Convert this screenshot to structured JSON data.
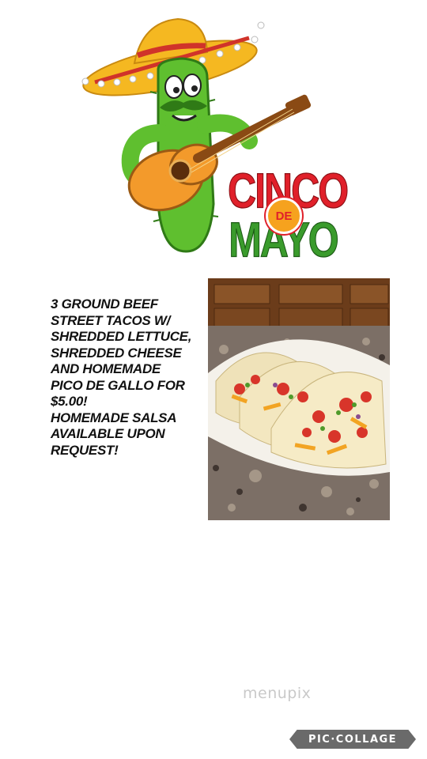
{
  "logo": {
    "word_top": "CINCO",
    "word_badge": "DE",
    "word_bottom": "MAYO"
  },
  "promo_lines": [
    "3 GROUND BEEF",
    "STREET TACOS W/",
    "SHREDDED LETTUCE,",
    "SHREDDED CHEESE",
    "AND HOMEMADE",
    "PICO DE GALLO FOR",
    "$5.00!",
    "HOMEMADE SALSA",
    "AVAILABLE UPON",
    "REQUEST!"
  ],
  "watermark": "menupix",
  "collage_badge": "PIC·COLLAGE",
  "colors": {
    "cinco_red": "#e0202a",
    "mayo_green": "#3a9b2c",
    "badge_orange": "#f6a21e",
    "badge_gray": "#6a6a6a"
  }
}
